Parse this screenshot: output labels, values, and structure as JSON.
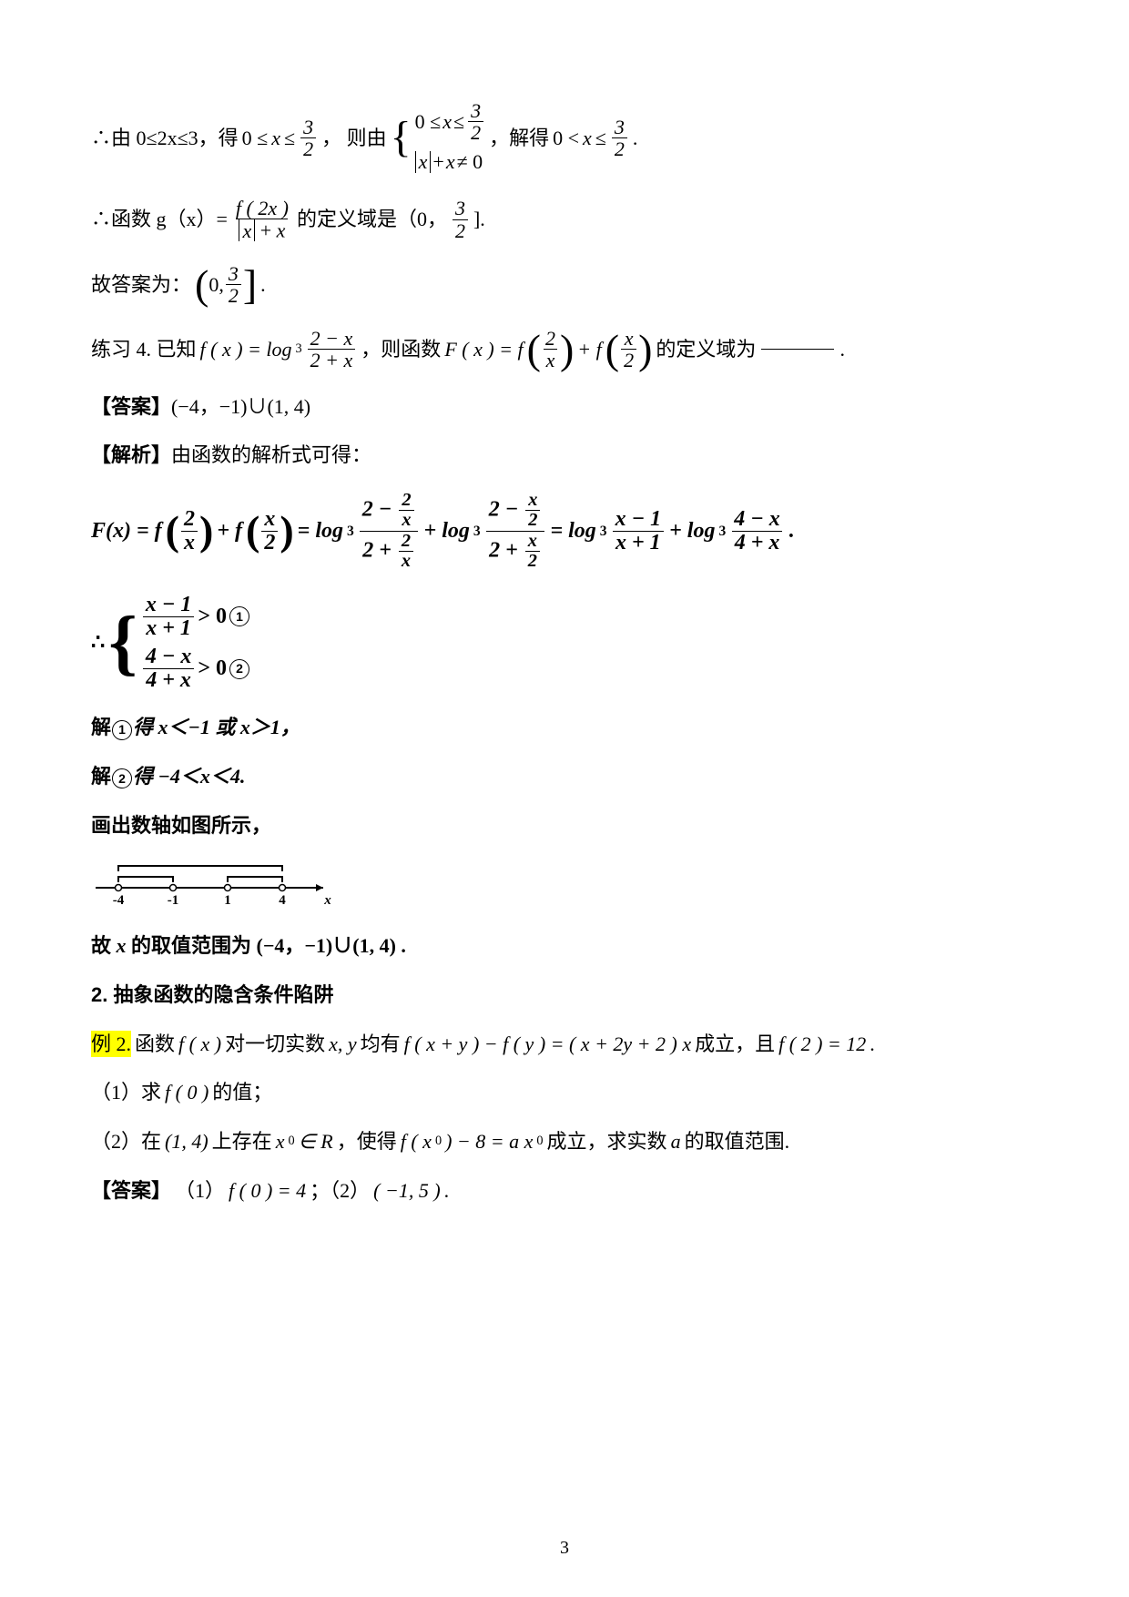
{
  "line1": {
    "prefix": "∴由 0≤2x≤3，得",
    "ineq_low": "0 ≤ ",
    "x": "x",
    "leq": " ≤ ",
    "three": "3",
    "two": "2",
    "mid": "，   则由",
    "row1a": "0 ≤ ",
    "row1b": " ≤ ",
    "row2a": " + ",
    "row2b": " ≠ 0",
    "after": "，解得",
    "final1": "0 < ",
    "final2": " ≤ ",
    "period": "."
  },
  "line2": {
    "prefix": "∴函数 g（x）= ",
    "fnum": "f ( 2x )",
    "mid": " 的定义域是（0， ",
    "three": "3",
    "two": "2",
    "close": " ]."
  },
  "line3": {
    "prefix": "故答案为： ",
    "zero": "0,",
    "three": "3",
    "two": "2",
    "period": "."
  },
  "ex4": {
    "label": "练习 4. 已知",
    "fx": "f ( x ) = log",
    "base3": "3",
    "num2mx": "2 − x",
    "den2px": "2 + x",
    "mid": "，则函数",
    "Fx": "F ( x ) = f",
    "twox_top": "2",
    "twox_bot": "x",
    "plus": " + f",
    "xtwo_top": "x",
    "xtwo_bot": "2",
    "tail": "的定义域为",
    "period": "."
  },
  "ans1": {
    "label": "【答案】",
    "text": "(−4，−1)∪(1, 4)"
  },
  "anlys_label": "【解析】",
  "anlys_text": "由函数的解析式可得：",
  "bigeq": {
    "Fx": "F(x) = f",
    "t1_top": "2",
    "t1_bot": "x",
    "plus1": " + f",
    "t2_top": "x",
    "t2_bot": "2",
    "eq1": " = log",
    "b3": "3",
    "f1_num_top": "2",
    "f1_num_bot": "x",
    "f1_den_top": "2",
    "f1_den_bot": "x",
    "plus2": " + log",
    "f2_num_top": "x",
    "f2_num_bot": "2",
    "f2_den_top": "x",
    "f2_den_bot": "2",
    "eq2": " = log",
    "s1_num": "x − 1",
    "s1_den": "x + 1",
    "plus3": " + log",
    "s2_num": "4 − x",
    "s2_den": "4 + x",
    "period": "."
  },
  "system": {
    "prefix": "∴",
    "r1_num": "x − 1",
    "r1_den": "x + 1",
    "r1_tail": " > 0",
    "r2_num": "4 − x",
    "r2_den": "4 + x",
    "r2_tail": " > 0",
    "c1": "1",
    "c2": "2"
  },
  "sol1": {
    "pre": "解",
    "c": "1",
    "text": "得 x＜−1 或 x＞1，"
  },
  "sol2": {
    "pre": "解",
    "c": "2",
    "text": "得 −4＜x＜4."
  },
  "drawline": "画出数轴如图所示，",
  "conclusion": {
    "pre": "故 ",
    "x": "x",
    "text": " 的取值范围为 (−4，−1)∪(1, 4) ."
  },
  "section2": "2. 抽象函数的隐含条件陷阱",
  "ex2": {
    "label": "例 2.",
    "t1": "函数",
    "fx": "f ( x )",
    "t2": "对一切实数",
    "xy": "x, y",
    "t3": "均有",
    "eq": "f ( x + y ) − f ( y ) = ( x + 2y + 2 ) x",
    "t4": "成立，且",
    "f2": "f ( 2 ) = 12",
    "period": "."
  },
  "q1": {
    "label": "（1）求",
    "fx": "f ( 0 )",
    "tail": "的值；"
  },
  "q2": {
    "label": "（2）在",
    "int": "(1, 4)",
    "t1": "上存在",
    "x0": "x",
    "sub0": "0",
    "in": " ∈ R",
    "t2": "，使得",
    "fx0": "f ( x",
    "fx0b": " ) − 8 = a x",
    "t3": "成立，求实数",
    "a": "a",
    "t4": "的取值范围."
  },
  "ans2": {
    "label": "【答案】",
    "p1": "（1） ",
    "f0": "f ( 0 ) = 4",
    "sep": " ；（2） ",
    "rng": "( −1, 5 )",
    "period": "."
  },
  "numberline": {
    "ticks": [
      "-4",
      "-1",
      "1",
      "4"
    ],
    "xlabel": "x"
  },
  "pagenumber": "3"
}
